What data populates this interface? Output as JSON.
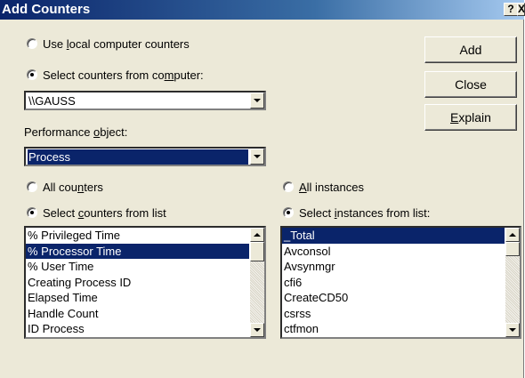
{
  "dialog": {
    "title": "Add Counters",
    "help_button": "?",
    "close_button": "X"
  },
  "source": {
    "local_option": [
      "Use ",
      "l",
      "ocal computer counters"
    ],
    "remote_option": [
      "Select counters from co",
      "m",
      "puter:"
    ],
    "selected": "remote",
    "computer_value": "\\\\GAUSS"
  },
  "buttons": {
    "add": "Add",
    "close": "Close",
    "explain": [
      "",
      "E",
      "xplain"
    ]
  },
  "performance_object": {
    "label": [
      "Performance ",
      "o",
      "bject:"
    ],
    "value": "Process"
  },
  "counters": {
    "all_option": [
      "All cou",
      "n",
      "ters"
    ],
    "list_option": [
      "Select ",
      "c",
      "ounters from list"
    ],
    "selected": "list",
    "items": [
      "% Privileged Time",
      "% Processor Time",
      "% User Time",
      "Creating Process ID",
      "Elapsed Time",
      "Handle Count",
      "ID Process"
    ],
    "selected_item": "% Processor Time"
  },
  "instances": {
    "all_option": [
      "",
      "A",
      "ll instances"
    ],
    "list_option": [
      "Select ",
      "i",
      "nstances from list:"
    ],
    "selected": "list",
    "items": [
      "_Total",
      "Avconsol",
      "Avsynmgr",
      "cfi6",
      "CreateCD50",
      "csrss",
      "ctfmon"
    ],
    "selected_item": "_Total"
  },
  "colors": {
    "title_bar": "#0a246a",
    "dialog_face": "#ece9d8",
    "selection": "#0a246a"
  }
}
